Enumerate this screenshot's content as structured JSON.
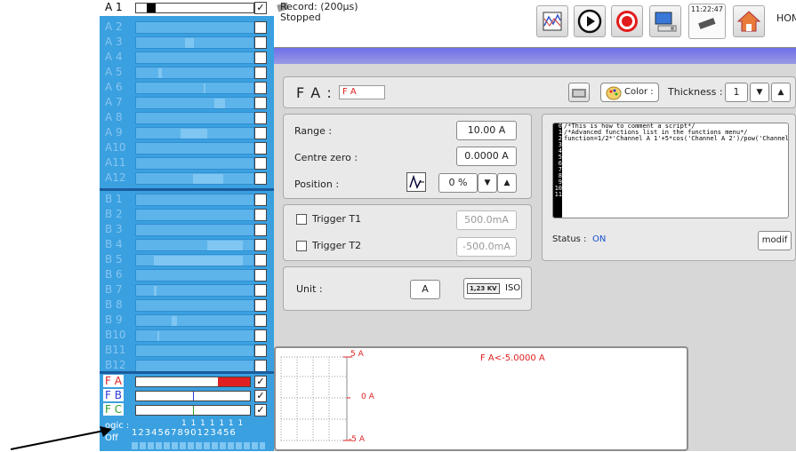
{
  "sidebar": {
    "top_channel": {
      "label": "A 1",
      "checked": true
    },
    "group1": [
      "A 2",
      "A 3",
      "A 4",
      "A 5",
      "A 6",
      "A 7",
      "A 8",
      "A 9",
      "A10",
      "A11",
      "A12"
    ],
    "group2": [
      "B 1",
      "B 2",
      "B 3",
      "B 4",
      "B 5",
      "B 6",
      "B 7",
      "B 8",
      "B 9",
      "B10",
      "B11",
      "B12"
    ],
    "math": [
      {
        "label": "F A",
        "color": "#e02020",
        "checked": true
      },
      {
        "label": "F B",
        "color": "#2a3ad8",
        "checked": true
      },
      {
        "label": "F C",
        "color": "#2aa02a",
        "checked": true
      }
    ],
    "logic_label_top": "ogic :",
    "logic_label_bottom": "Off",
    "logic_digits_top": "1 1 1 1 1 1 1",
    "logic_digits": "1234567890123456"
  },
  "topbar": {
    "record_line1": "Record: (200µs)",
    "record_line2": "Stopped",
    "clock_time": "11:22:47",
    "home_label": "HOM",
    "icons": [
      "chart-icon",
      "play-icon",
      "record-icon",
      "monitor-icon",
      "chip-icon",
      "home-icon"
    ]
  },
  "channel": {
    "title_prefix": "F A :",
    "name_value": "F A",
    "color_label": "Color :",
    "thickness_label": "Thickness :",
    "thickness_value": "1"
  },
  "scale": {
    "range_label": "Range  :",
    "range_value": "10.00 A",
    "centre_label": "Centre zero :",
    "centre_value": "0.0000 A",
    "position_label": "Position :",
    "position_value": "0 %"
  },
  "triggers": {
    "t1_label": "Trigger T1",
    "t1_value": "500.0mA",
    "t2_label": "Trigger T2",
    "t2_value": "-500.0mA"
  },
  "unit": {
    "label": "Unit  :",
    "value": "A",
    "iso_badge": "1,23 KV",
    "iso_label": "ISO"
  },
  "script": {
    "line_numbers": [
      "0",
      "1",
      "2",
      "3",
      "4",
      "5",
      "6",
      "7",
      "8",
      "9",
      "10",
      "11"
    ],
    "lines": [
      "/*This is how to comment a script*/",
      "/*Advanced functions list in the functions menu*/",
      "function=1/2*'Channel A 1'+5*cos('Channel A 2')/pow('Channel ...",
      "",
      "",
      "",
      "",
      "",
      "",
      "",
      "",
      ""
    ],
    "status_label": "Status :",
    "status_value": "ON",
    "modif_label": "modif"
  },
  "graph": {
    "top_label": "5 A",
    "mid_label": "0 A",
    "bottom_label": "-5 A",
    "trigger_text": "F A<-5.0000 A"
  },
  "colors": {
    "sidebar_bg": "#3aa0e0",
    "band": "#7b7be8",
    "fa_red": "#e02020",
    "status_blue": "#1a4fd0"
  }
}
